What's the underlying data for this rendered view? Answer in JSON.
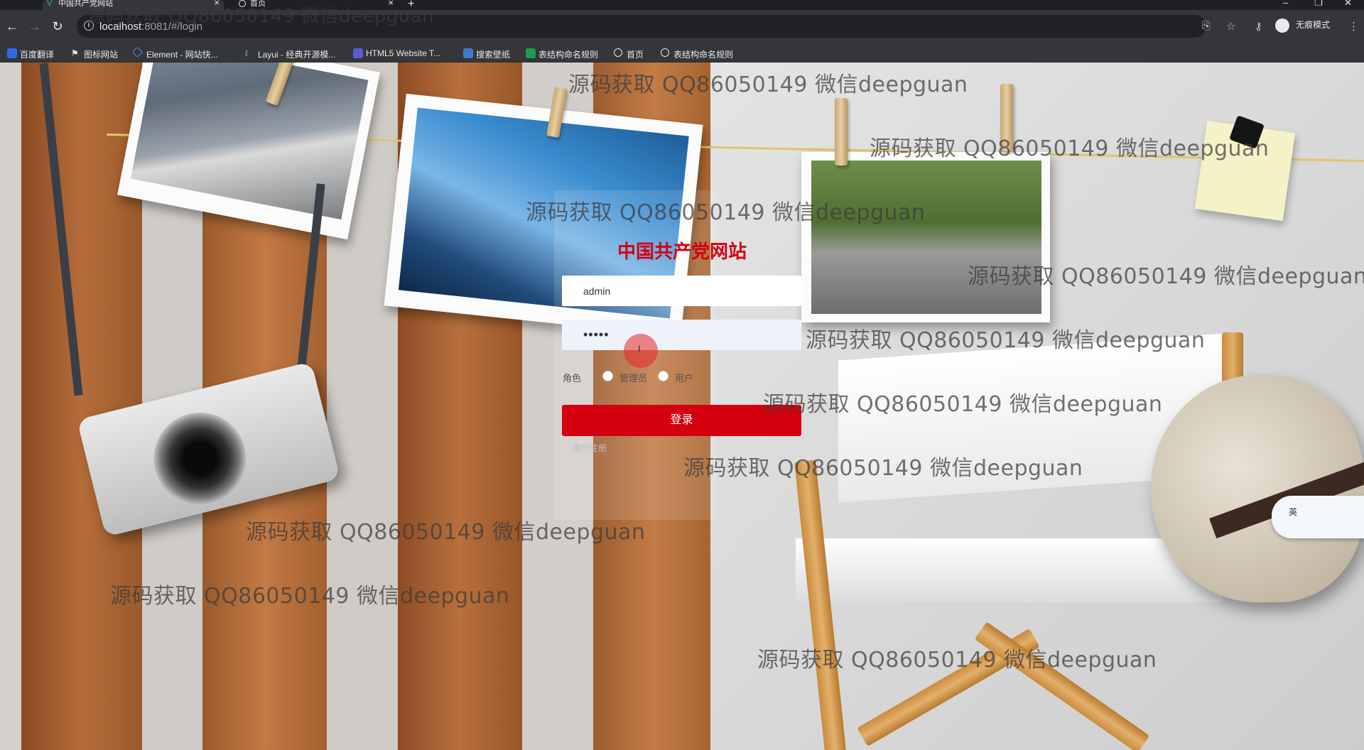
{
  "browser": {
    "tabs": [
      {
        "title": "中国共产党网站",
        "active": true
      },
      {
        "title": "首页",
        "active": false
      }
    ],
    "new_tab": "+",
    "address": {
      "host": "localhost",
      "rest": ":8081/#/login"
    },
    "incognito_label": "无痕模式",
    "bookmarks": [
      {
        "label": "百度翻译",
        "icon": "baidu-translate-icon",
        "color": "#2b6de0"
      },
      {
        "label": "图标网站",
        "icon": "flag-icon",
        "color": "#e8eaed"
      },
      {
        "label": "Element - 网站快...",
        "icon": "element-icon",
        "color": "#4a90e2"
      },
      {
        "label": "Layui - 经典开源模...",
        "icon": "layui-icon",
        "color": "#9aa0a6"
      },
      {
        "label": "HTML5 Website T...",
        "icon": "html5-icon",
        "color": "#5b5bd6"
      },
      {
        "label": "搜索壁纸",
        "icon": "wallpaper-icon",
        "color": "#3d7bd1"
      },
      {
        "label": "表结构命名规则",
        "icon": "sheet-icon",
        "color": "#1e9e4a"
      },
      {
        "label": "首页",
        "icon": "globe-icon",
        "color": "#e8eaed"
      },
      {
        "label": "表结构命名规则",
        "icon": "globe-icon",
        "color": "#e8eaed"
      }
    ]
  },
  "login": {
    "title": "中国共产党网站",
    "username_value": "admin",
    "password_value": "•••••",
    "role_label": "角色",
    "role_options": [
      "管理员",
      "用户"
    ],
    "submit_label": "登录",
    "register_label": "用户注册",
    "cursor_glyph": "I"
  },
  "ime": {
    "label": "英"
  },
  "watermark_text": "源码获取 QQ86050149 微信deepguan",
  "watermarks": [
    "源码获取 QQ86050149 微信deepguan",
    "源码获取 QQ86050149 微信deepguan",
    "源码获取 QQ86050149 微信deepguan",
    "源码获取 QQ86050149 微信deepguan",
    "源码获取 QQ86050149 微信deepguan",
    "源码获取 QQ86050149 微信deepguan",
    "源码获取 QQ86050149 微信deepguan",
    "源码获取 QQ86050149 微信deepguan",
    "源码获取 QQ86050149 微信deepguan",
    "源码获取 QQ86050149 微信deepguan",
    "源码获取 QQ86050149 微信deepguan"
  ],
  "colors": {
    "accent": "#d4000f",
    "chrome_dark": "#35363a",
    "wood": "#b86f3c"
  }
}
